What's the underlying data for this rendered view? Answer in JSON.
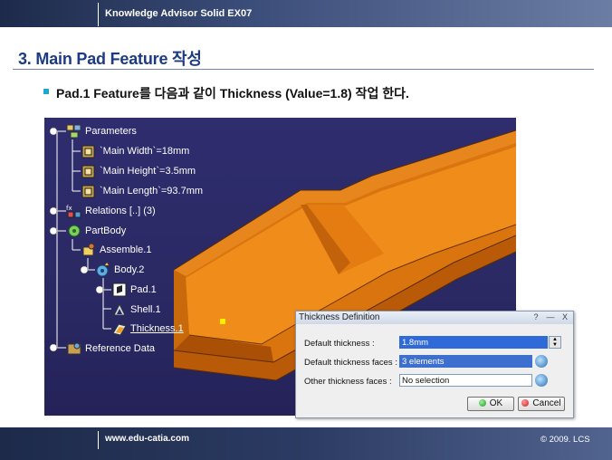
{
  "header": {
    "course_title": "Knowledge Advisor Solid EX07"
  },
  "slide": {
    "title": "3. Main Pad Feature 작성",
    "bullet": "Pad.1 Feature를 다음과 같이 Thickness (Value=1.8) 작업 한다."
  },
  "tree": {
    "parameters": "Parameters",
    "main_width": "`Main Width`=18mm",
    "main_height": "`Main Height`=3.5mm",
    "main_length": "`Main Length`=93.7mm",
    "relations": "Relations [..] (3)",
    "partbody": "PartBody",
    "assemble": "Assemble.1",
    "body": "Body.2",
    "pad": "Pad.1",
    "shell": "Shell.1",
    "thickness": "Thickness.1",
    "reference_data": "Reference Data"
  },
  "dialog": {
    "title": "Thickness Definition",
    "help": "?",
    "minimize": "—",
    "close": "X",
    "default_thickness_label": "Default thickness :",
    "default_thickness_value": "1.8mm",
    "default_faces_label": "Default thickness faces :",
    "default_faces_value": "3 elements",
    "other_faces_label": "Other thickness faces :",
    "other_faces_value": "No selection",
    "ok": "OK",
    "cancel": "Cancel"
  },
  "footer": {
    "url": "www.edu-catia.com",
    "copyright": "© 2009. LCS"
  },
  "colors": {
    "title_blue": "#1c3b84",
    "viewport_bg": "#2b2a66",
    "part_orange": "#e07a10",
    "bullet_cyan": "#1fa8c9"
  }
}
